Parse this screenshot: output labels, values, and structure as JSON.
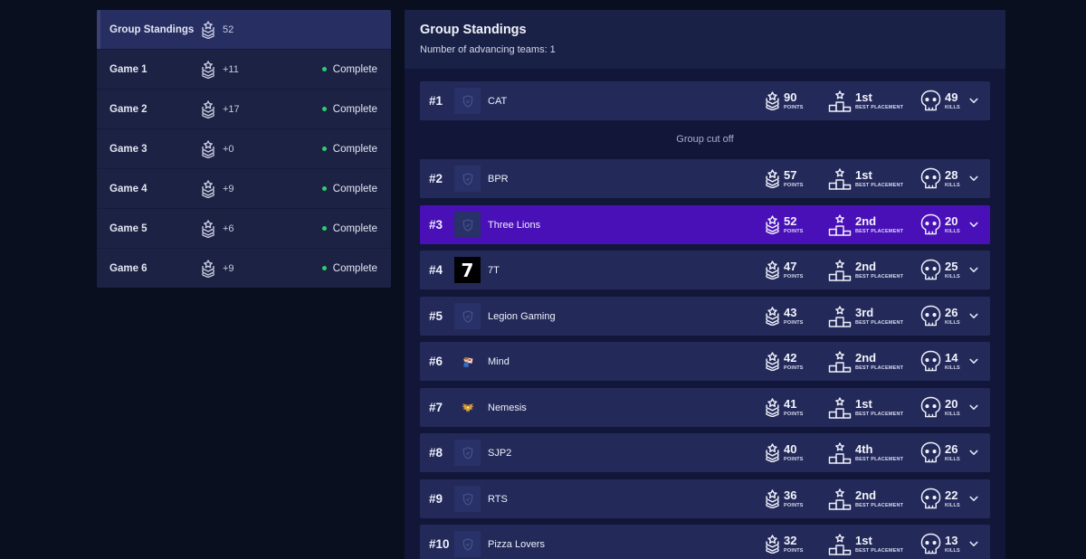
{
  "sidebar": {
    "items": [
      {
        "label": "Group Standings",
        "points": "52",
        "status": "",
        "active": true
      },
      {
        "label": "Game 1",
        "points": "+11",
        "status": "Complete"
      },
      {
        "label": "Game 2",
        "points": "+17",
        "status": "Complete"
      },
      {
        "label": "Game 3",
        "points": "+0",
        "status": "Complete"
      },
      {
        "label": "Game 4",
        "points": "+9",
        "status": "Complete"
      },
      {
        "label": "Game 5",
        "points": "+6",
        "status": "Complete"
      },
      {
        "label": "Game 6",
        "points": "+9",
        "status": "Complete"
      }
    ]
  },
  "main": {
    "title": "Group Standings",
    "subtitle": "Number of advancing teams: 1",
    "cutoff_label": "Group cut off",
    "stat_labels": {
      "points": "POINTS",
      "placement": "BEST PLACEMENT",
      "kills": "KILLS"
    },
    "teams": [
      {
        "rank": "#1",
        "name": "CAT",
        "points": "90",
        "placement": "1st",
        "kills": "49",
        "logo": "shield-placeholder-icon"
      },
      {
        "rank": "#2",
        "name": "BPR",
        "points": "57",
        "placement": "1st",
        "kills": "28",
        "logo": "shield-placeholder-icon"
      },
      {
        "rank": "#3",
        "name": "Three Lions",
        "points": "52",
        "placement": "2nd",
        "kills": "20",
        "logo": "shield-placeholder-icon",
        "highlight": true
      },
      {
        "rank": "#4",
        "name": "7T",
        "points": "47",
        "placement": "2nd",
        "kills": "25",
        "logo": "seven-logo"
      },
      {
        "rank": "#5",
        "name": "Legion Gaming",
        "points": "43",
        "placement": "3rd",
        "kills": "26",
        "logo": "shield-placeholder-icon"
      },
      {
        "rank": "#6",
        "name": "Mind",
        "points": "42",
        "placement": "2nd",
        "kills": "14",
        "logo": "cartoon-character-logo"
      },
      {
        "rank": "#7",
        "name": "Nemesis",
        "points": "41",
        "placement": "1st",
        "kills": "20",
        "logo": "winged-emblem-logo"
      },
      {
        "rank": "#8",
        "name": "SJP2",
        "points": "40",
        "placement": "4th",
        "kills": "26",
        "logo": "shield-placeholder-icon"
      },
      {
        "rank": "#9",
        "name": "RTS",
        "points": "36",
        "placement": "2nd",
        "kills": "22",
        "logo": "shield-placeholder-icon"
      },
      {
        "rank": "#10",
        "name": "Pizza Lovers",
        "points": "32",
        "placement": "1st",
        "kills": "13",
        "logo": "shield-placeholder-icon"
      }
    ]
  },
  "colors": {
    "background": "#0a0f1f",
    "panel": "#12173a",
    "row": "#232a5a",
    "highlight_row": "#4a10b8",
    "status_complete": "#2ecc71"
  }
}
